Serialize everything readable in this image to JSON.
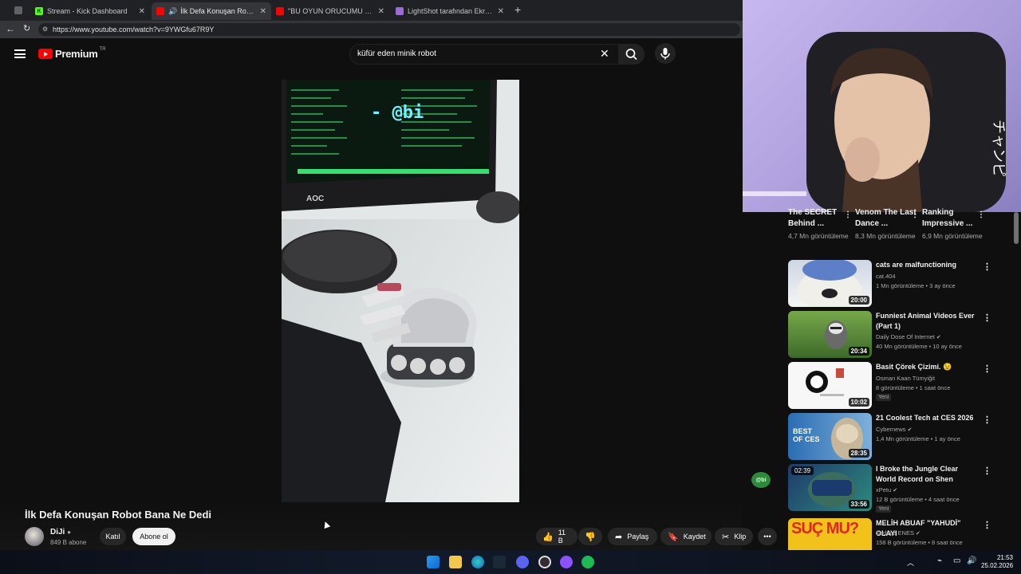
{
  "browser": {
    "tabs": [
      {
        "label": "Stream - Kick Dashboard",
        "favicon": "kick-icon"
      },
      {
        "label": "İlk Defa Konuşan Robot Bana Ne Dedi",
        "favicon": "youtube-icon",
        "active": true
      },
      {
        "label": "\"BU OYUN ORUCUMU BOZDURDU\"",
        "favicon": "youtube-icon"
      },
      {
        "label": "LightShot tarafından Ekran Görüntüsü",
        "favicon": "lightshot-icon"
      }
    ],
    "url": "https://www.youtube.com/watch?v=9YWGfu67R9Y"
  },
  "header": {
    "logo_text": "Premium",
    "logo_region": "TR",
    "search_query": "küfür eden minik robot"
  },
  "video": {
    "watermark": "- @bi",
    "monitor_brand": "AOC",
    "title": "İlk Defa Konuşan Robot Bana Ne Dedi",
    "channel": "DiJi",
    "subscribers": "849 B abone",
    "join_label": "Katıl",
    "subscribe_label": "Abone ol",
    "likes": "11 B",
    "share_label": "Paylaş",
    "save_label": "Kaydet",
    "clip_label": "Klip"
  },
  "sidebar": {
    "partial": [
      {
        "title": "The SECRET Behind ...",
        "views": "4,7 Mn görüntüleme"
      },
      {
        "title": "Venom The Last Dance ...",
        "views": "8,3 Mn görüntüleme"
      },
      {
        "title": "Ranking Impressive ...",
        "views": "6,9 Mn görüntüleme"
      }
    ],
    "items": [
      {
        "title": "cats are malfunctioning",
        "channel": "cat.404",
        "views": "1 Mn görüntüleme",
        "age": "3 ay önce",
        "duration": "20:00",
        "verified": false,
        "badge": ""
      },
      {
        "title": "Funniest Animal Videos Ever (Part 1)",
        "channel": "Daily Dose Of Internet",
        "views": "40 Mn görüntüleme",
        "age": "10 ay önce",
        "duration": "20:34",
        "verified": true,
        "badge": ""
      },
      {
        "title": "Basit Çörek Çizimi. 😉",
        "channel": "Osman Kaan Tümyiğit",
        "views": "8 görüntüleme",
        "age": "1 saat önce",
        "duration": "10:02",
        "verified": false,
        "badge": "Yeni"
      },
      {
        "title": "21 Coolest Tech at CES 2026",
        "channel": "Cybernews",
        "views": "1,4 Mn görüntüleme",
        "age": "1 ay önce",
        "duration": "28:35",
        "verified": true,
        "badge": "",
        "thumb_text": "BEST OF CES"
      },
      {
        "title": "I Broke the Jungle Clear World Record on Shen",
        "channel": "xPetu",
        "views": "12 B görüntüleme",
        "age": "4 saat önce",
        "duration": "33:56",
        "verified": true,
        "badge": "Yeni",
        "thumb_overlay": "02:39"
      },
      {
        "title": "MELİH ABUAF \"YAHUDİ\" OLAYI",
        "channel": "Sadece ENES",
        "views": "158 B görüntüleme",
        "age": "8 saat önce",
        "duration": "",
        "verified": true,
        "badge": "",
        "thumb_text": "SUÇ MU?"
      }
    ],
    "floating_badge": "@bi"
  },
  "taskbar": {
    "time": "21:53",
    "date": "25.02.2026"
  }
}
